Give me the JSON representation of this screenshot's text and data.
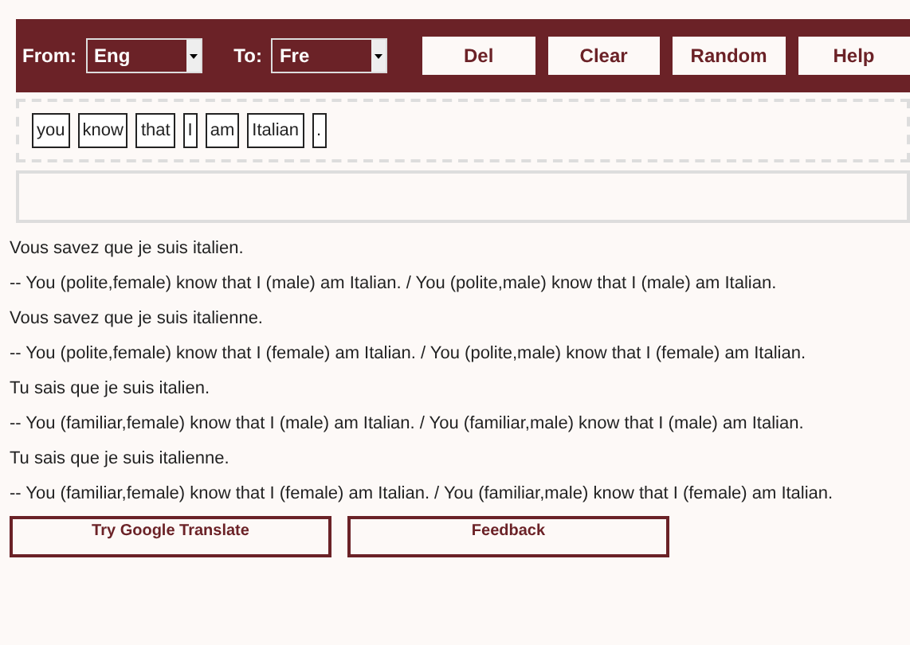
{
  "toolbar": {
    "from_label": "From:",
    "from_value": "Eng",
    "to_label": "To:",
    "to_value": "Fre",
    "buttons": [
      "Del",
      "Clear",
      "Random",
      "Help"
    ]
  },
  "tokens": [
    "you",
    "know",
    "that",
    "I",
    "am",
    "Italian",
    "."
  ],
  "results": [
    {
      "french": "Vous savez que je suis italien.",
      "english": "-- You (polite,female) know that I (male) am Italian. / You (polite,male) know that I (male) am Italian."
    },
    {
      "french": "Vous savez que je suis italienne.",
      "english": "-- You (polite,female) know that I (female) am Italian. / You (polite,male) know that I (female) am Italian."
    },
    {
      "french": "Tu sais que je suis italien.",
      "english": "-- You (familiar,female) know that I (male) am Italian. / You (familiar,male) know that I (male) am Italian."
    },
    {
      "french": "Tu sais que je suis italienne.",
      "english": "-- You (familiar,female) know that I (female) am Italian. / You (familiar,male) know that I (female) am Italian."
    }
  ],
  "bottom_buttons": [
    "Try Google Translate",
    "Feedback"
  ]
}
